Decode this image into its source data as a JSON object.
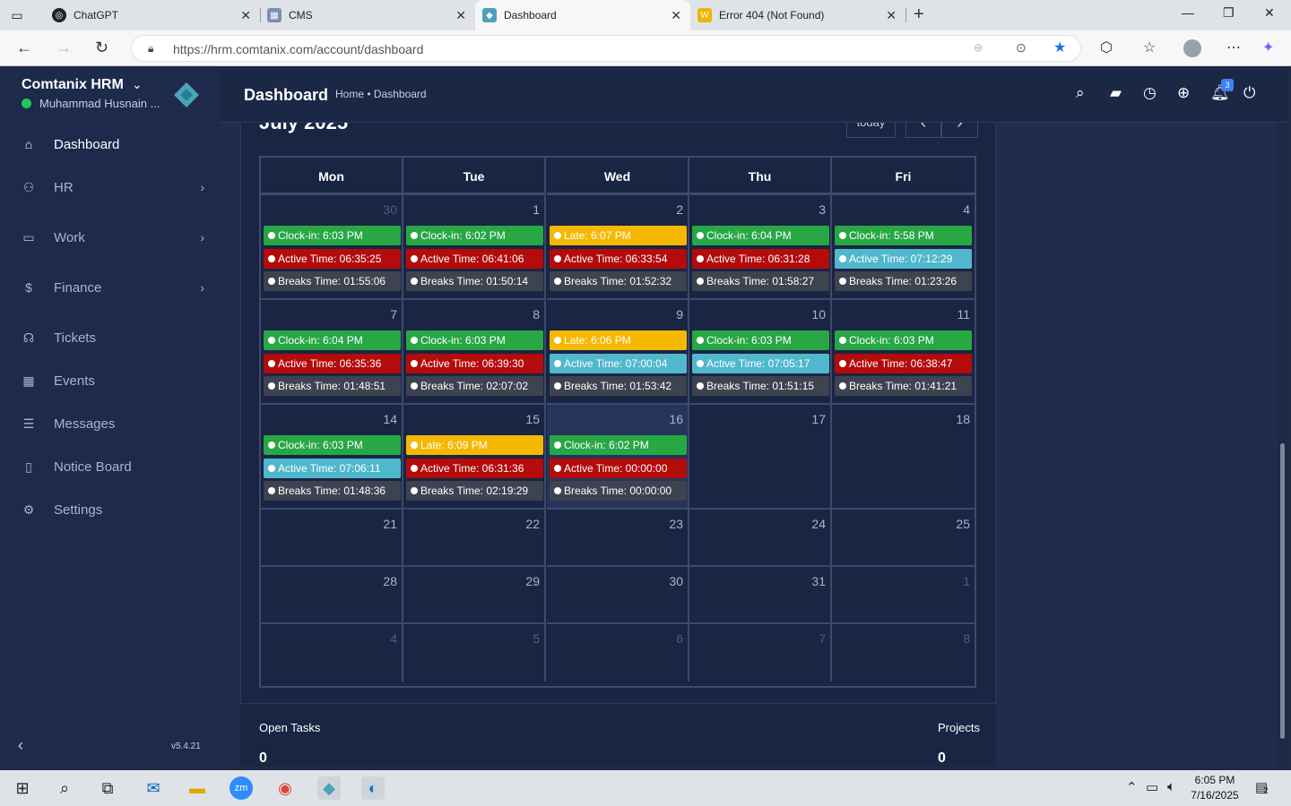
{
  "browser": {
    "tabs": [
      {
        "title": "ChatGPT",
        "icon": "chatgpt-icon",
        "active": false
      },
      {
        "title": "CMS",
        "icon": "cms-icon",
        "active": false
      },
      {
        "title": "Dashboard",
        "icon": "comtanix-icon",
        "active": true
      },
      {
        "title": "Error 404 (Not Found)",
        "icon": "w-icon",
        "active": false
      }
    ],
    "url": "https://hrm.comtanix.com/account/dashboard"
  },
  "sidebar": {
    "brand": "Comtanix HRM",
    "user": "Muhammad Husnain ...",
    "items": [
      {
        "label": "Dashboard",
        "icon": "home-icon",
        "active": true,
        "has_children": false
      },
      {
        "label": "HR",
        "icon": "people-icon",
        "active": false,
        "has_children": true
      },
      {
        "label": "Work",
        "icon": "briefcase-icon",
        "active": false,
        "has_children": true
      },
      {
        "label": "Finance",
        "icon": "dollar-icon",
        "active": false,
        "has_children": true
      },
      {
        "label": "Tickets",
        "icon": "headset-icon",
        "active": false,
        "has_children": false
      },
      {
        "label": "Events",
        "icon": "calendar-icon",
        "active": false,
        "has_children": false
      },
      {
        "label": "Messages",
        "icon": "chat-icon",
        "active": false,
        "has_children": false
      },
      {
        "label": "Notice Board",
        "icon": "clipboard-icon",
        "active": false,
        "has_children": false
      },
      {
        "label": "Settings",
        "icon": "gear-icon",
        "active": false,
        "has_children": false
      }
    ],
    "version": "v5.4.21"
  },
  "header": {
    "title": "Dashboard",
    "breadcrumb": "Home • Dashboard",
    "notification_count": "3"
  },
  "calendar": {
    "month_title": "July 2025",
    "today_label": "today",
    "prev_label": "‹",
    "next_label": "›",
    "days": [
      "Mon",
      "Tue",
      "Wed",
      "Thu",
      "Fri"
    ],
    "weeks": [
      [
        {
          "day": "30",
          "other": true,
          "events": [
            {
              "text": "Clock-in: 6:03 PM",
              "color": "green"
            },
            {
              "text": "Active Time: 06:35:25",
              "color": "red"
            },
            {
              "text": "Breaks Time: 01:55:06",
              "color": "dark"
            }
          ]
        },
        {
          "day": "1",
          "events": [
            {
              "text": "Clock-in: 6:02 PM",
              "color": "green"
            },
            {
              "text": "Active Time: 06:41:06",
              "color": "red"
            },
            {
              "text": "Breaks Time: 01:50:14",
              "color": "dark"
            }
          ]
        },
        {
          "day": "2",
          "events": [
            {
              "text": "Late: 6:07 PM",
              "color": "yellow"
            },
            {
              "text": "Active Time: 06:33:54",
              "color": "red"
            },
            {
              "text": "Breaks Time: 01:52:32",
              "color": "dark"
            }
          ]
        },
        {
          "day": "3",
          "events": [
            {
              "text": "Clock-in: 6:04 PM",
              "color": "green"
            },
            {
              "text": "Active Time: 06:31:28",
              "color": "red"
            },
            {
              "text": "Breaks Time: 01:58:27",
              "color": "dark"
            }
          ]
        },
        {
          "day": "4",
          "events": [
            {
              "text": "Clock-in: 5:58 PM",
              "color": "green"
            },
            {
              "text": "Active Time: 07:12:29",
              "color": "cyan"
            },
            {
              "text": "Breaks Time: 01:23:26",
              "color": "dark"
            }
          ]
        }
      ],
      [
        {
          "day": "7",
          "events": [
            {
              "text": "Clock-in: 6:04 PM",
              "color": "green"
            },
            {
              "text": "Active Time: 06:35:36",
              "color": "red"
            },
            {
              "text": "Breaks Time: 01:48:51",
              "color": "dark"
            }
          ]
        },
        {
          "day": "8",
          "events": [
            {
              "text": "Clock-in: 6:03 PM",
              "color": "green"
            },
            {
              "text": "Active Time: 06:39:30",
              "color": "red"
            },
            {
              "text": "Breaks Time: 02:07:02",
              "color": "dark"
            }
          ]
        },
        {
          "day": "9",
          "events": [
            {
              "text": "Late: 6:06 PM",
              "color": "yellow"
            },
            {
              "text": "Active Time: 07:00:04",
              "color": "cyan"
            },
            {
              "text": "Breaks Time: 01:53:42",
              "color": "dark"
            }
          ]
        },
        {
          "day": "10",
          "events": [
            {
              "text": "Clock-in: 6:03 PM",
              "color": "green"
            },
            {
              "text": "Active Time: 07:05:17",
              "color": "cyan"
            },
            {
              "text": "Breaks Time: 01:51:15",
              "color": "dark"
            }
          ]
        },
        {
          "day": "11",
          "events": [
            {
              "text": "Clock-in: 6:03 PM",
              "color": "green"
            },
            {
              "text": "Active Time: 06:38:47",
              "color": "red"
            },
            {
              "text": "Breaks Time: 01:41:21",
              "color": "dark"
            }
          ]
        }
      ],
      [
        {
          "day": "14",
          "events": [
            {
              "text": "Clock-in: 6:03 PM",
              "color": "green"
            },
            {
              "text": "Active Time: 07:06:11",
              "color": "cyan"
            },
            {
              "text": "Breaks Time: 01:48:36",
              "color": "dark"
            }
          ]
        },
        {
          "day": "15",
          "events": [
            {
              "text": "Late: 6:09 PM",
              "color": "yellow"
            },
            {
              "text": "Active Time: 06:31:36",
              "color": "red"
            },
            {
              "text": "Breaks Time: 02:19:29",
              "color": "dark"
            }
          ]
        },
        {
          "day": "16",
          "today": true,
          "events": [
            {
              "text": "Clock-in: 6:02 PM",
              "color": "green"
            },
            {
              "text": "Active Time: 00:00:00",
              "color": "red"
            },
            {
              "text": "Breaks Time: 00:00:00",
              "color": "dark"
            }
          ]
        },
        {
          "day": "17",
          "events": []
        },
        {
          "day": "18",
          "events": []
        }
      ],
      [
        {
          "day": "21",
          "events": []
        },
        {
          "day": "22",
          "events": []
        },
        {
          "day": "23",
          "events": []
        },
        {
          "day": "24",
          "events": []
        },
        {
          "day": "25",
          "events": []
        }
      ],
      [
        {
          "day": "28",
          "events": []
        },
        {
          "day": "29",
          "events": []
        },
        {
          "day": "30",
          "events": []
        },
        {
          "day": "31",
          "events": []
        },
        {
          "day": "1",
          "other": true,
          "events": []
        }
      ],
      [
        {
          "day": "4",
          "other": true,
          "events": []
        },
        {
          "day": "5",
          "other": true,
          "events": []
        },
        {
          "day": "6",
          "other": true,
          "events": []
        },
        {
          "day": "7",
          "other": true,
          "events": []
        },
        {
          "day": "8",
          "other": true,
          "events": []
        }
      ]
    ]
  },
  "stats": {
    "open_tasks_label": "Open Tasks",
    "open_tasks_value": "0",
    "projects_label": "Projects",
    "projects_value": "0"
  },
  "taskbar": {
    "time": "6:05 PM",
    "date": "7/16/2025",
    "notifications": "2"
  },
  "colors": {
    "sidebar_bg": "#1d2a4b",
    "content_bg": "#1a2544",
    "clock_in": "#28a745",
    "late": "#f5b800",
    "active_low": "#b40b0b",
    "active_ok": "#50b8cc",
    "breaks": "#3e4350"
  }
}
